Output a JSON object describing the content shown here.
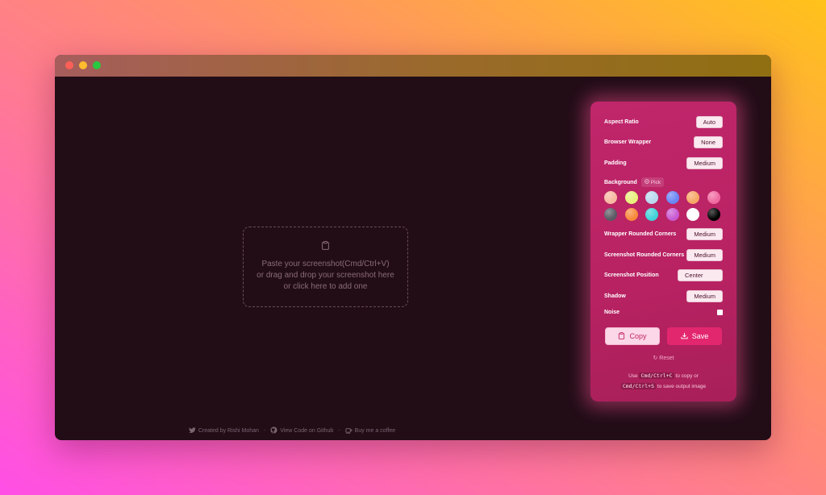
{
  "dropzone": {
    "line1": "Paste your screenshot(Cmd/Ctrl+V)",
    "line2": "or drag and drop your screenshot here",
    "line3": "or click here to add one"
  },
  "footer": {
    "credit": "Created by Rishi Mohan",
    "github": "View Code on Github",
    "coffee": "Buy me a coffee",
    "sep": "-"
  },
  "panel": {
    "aspect_ratio": {
      "label": "Aspect Ratio",
      "value": "Auto"
    },
    "browser_wrapper": {
      "label": "Browser Wrapper",
      "value": "None"
    },
    "padding": {
      "label": "Padding",
      "value": "Medium"
    },
    "background": {
      "label": "Background",
      "pick": "Pick"
    },
    "wrapper_rounded": {
      "label": "Wrapper Rounded Corners",
      "value": "Medium"
    },
    "screenshot_rounded": {
      "label": "Screenshot Rounded Corners",
      "value": "Medium"
    },
    "screenshot_position": {
      "label": "Screenshot Position",
      "value": "Center"
    },
    "shadow": {
      "label": "Shadow",
      "value": "Medium"
    },
    "noise": {
      "label": "Noise"
    },
    "copy_label": "Copy",
    "save_label": "Save",
    "reset_label": "Reset",
    "hint": {
      "use": "Use",
      "copy_key": "Cmd/Ctrl+C",
      "to_copy": "to copy or",
      "save_key": "Cmd/Ctrl+S",
      "to_save": "to save output image"
    }
  },
  "swatches": [
    "#f7b8a0",
    "#e8f07a",
    "#b9d9f0",
    "#6a86f5",
    "#f6a765",
    "#f06aa0",
    "#5b5a64",
    "#f7893a",
    "#3fd3d8",
    "#c85ad2",
    "#ffffff",
    "#000000"
  ]
}
